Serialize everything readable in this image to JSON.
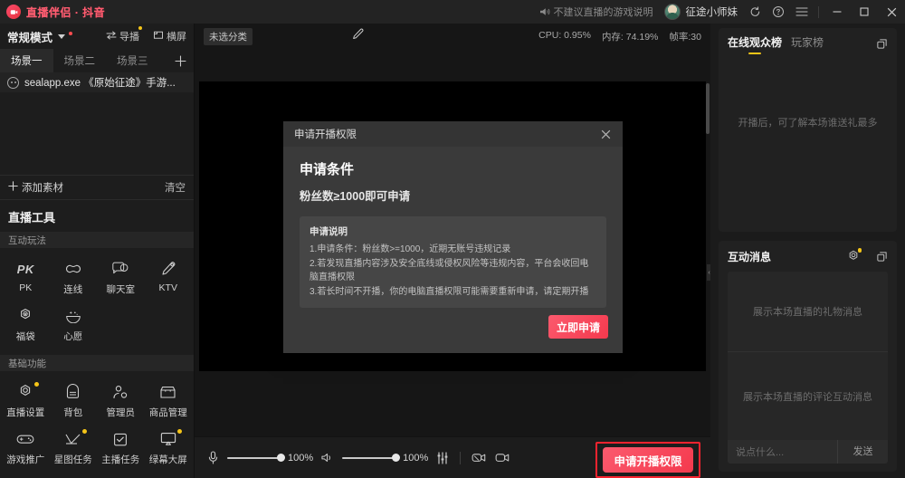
{
  "titlebar": {
    "app_title": "直播伴侣 · 抖音",
    "logo_icon": "camera-badge-icon",
    "note_icon": "megaphone-icon",
    "note_text": "不建议直播的游戏说明",
    "user_name": "征途小师妹",
    "avatar_icon": "avatar",
    "refresh_icon": "refresh-icon",
    "help_icon": "help-circle-icon",
    "menu_icon": "hamburger-menu-icon",
    "minimize_icon": "minimize-icon",
    "maximize_icon": "maximize-icon",
    "close_icon": "close-icon"
  },
  "left": {
    "mode_label": "常规模式",
    "guide_label": "导播",
    "guide_icon": "switch-arrows-icon",
    "orientation_label": "横屏",
    "orientation_icon": "landscape-frame-icon",
    "scene_tabs": [
      {
        "label": "场景一",
        "active": true
      },
      {
        "label": "场景二",
        "active": false
      },
      {
        "label": "场景三",
        "active": false
      }
    ],
    "add_scene_icon": "plus-icon",
    "sources": [
      {
        "label": "sealapp.exe 《原始征途》手游...",
        "icon": "window-capture-icon"
      }
    ],
    "add_material_label": "添加素材",
    "add_material_icon": "plus-icon",
    "clear_label": "清空",
    "tools_title": "直播工具",
    "groups": [
      {
        "title": "互动玩法",
        "items": [
          {
            "label": "PK",
            "icon": "pk-icon",
            "badge": false
          },
          {
            "label": "连线",
            "icon": "link-icon",
            "badge": false
          },
          {
            "label": "聊天室",
            "icon": "chatroom-icon",
            "badge": false
          },
          {
            "label": "KTV",
            "icon": "microphone-icon",
            "badge": false
          },
          {
            "label": "福袋",
            "icon": "lucky-bag-icon",
            "badge": false
          },
          {
            "label": "心愿",
            "icon": "wish-icon",
            "badge": false
          }
        ]
      },
      {
        "title": "基础功能",
        "items": [
          {
            "label": "直播设置",
            "icon": "settings-gear-icon",
            "badge": true
          },
          {
            "label": "背包",
            "icon": "backpack-icon",
            "badge": false
          },
          {
            "label": "管理员",
            "icon": "admin-user-icon",
            "badge": false
          },
          {
            "label": "商品管理",
            "icon": "shop-icon",
            "badge": false
          },
          {
            "label": "游戏推广",
            "icon": "gamepad-icon",
            "badge": false
          },
          {
            "label": "星图任务",
            "icon": "star-chart-icon",
            "badge": true
          },
          {
            "label": "主播任务",
            "icon": "task-check-icon",
            "badge": false
          },
          {
            "label": "绿幕大屏",
            "icon": "green-screen-icon",
            "badge": true
          }
        ]
      }
    ]
  },
  "center": {
    "category_chip": "未选分类",
    "edit_icon": "pencil-icon",
    "stats": [
      "CPU: 0.95%",
      "内存: 74.19%",
      "帧率:30"
    ],
    "bottom": {
      "mic_icon": "microphone-icon",
      "mic_value": "100%",
      "speaker_icon": "speaker-icon",
      "speaker_value": "100%",
      "mixer_icon": "audio-mixer-icon",
      "camera_off_icon": "camera-disabled-icon",
      "camera_icon": "camera-icon",
      "apply_button_label": "申请开播权限"
    }
  },
  "right": {
    "rank_tabs": [
      {
        "label": "在线观众榜",
        "active": true
      },
      {
        "label": "玩家榜",
        "active": false
      }
    ],
    "rank_popout_icon": "popout-window-icon",
    "rank_empty_text": "开播后，可了解本场谁送礼最多",
    "msg_title": "互动消息",
    "msg_settings_icon": "settings-gear-icon",
    "msg_popout_icon": "popout-window-icon",
    "gift_placeholder": "展示本场直播的礼物消息",
    "comment_placeholder": "展示本场直播的评论互动消息",
    "input_placeholder": "说点什么...",
    "send_label": "发送"
  },
  "modal": {
    "header_title": "申请开播权限",
    "close_icon": "close-icon",
    "heading": "申请条件",
    "subheading": "粉丝数≥1000即可申请",
    "note_title": "申请说明",
    "note_lines": [
      "1.申请条件：粉丝数>=1000，近期无账号违规记录",
      "2.若发现直播内容涉及安全底线或侵权风险等违规内容，平台会收回电脑直播权限",
      "3.若长时间不开播，你的电脑直播权限可能需要重新申请，请定期开播"
    ],
    "primary_button": "立即申请"
  },
  "colors": {
    "brand_red": "#f4394d",
    "accent_yellow": "#f5c518",
    "highlight_border": "#f5232f"
  }
}
